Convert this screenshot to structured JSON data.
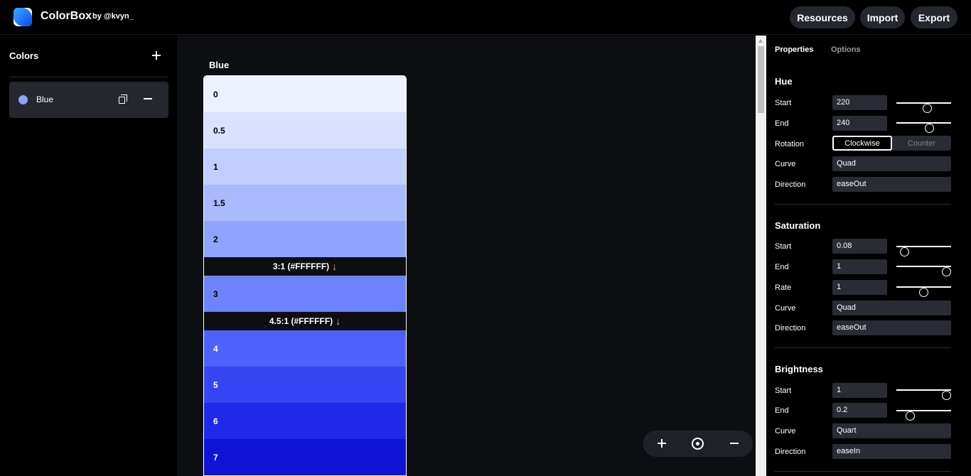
{
  "header": {
    "app_name": "ColorBox",
    "byline": "by @kvyn_",
    "buttons": {
      "resources": "Resources",
      "import": "Import",
      "export": "Export"
    }
  },
  "sidebar": {
    "title": "Colors",
    "items": [
      {
        "label": "Blue",
        "color": "#8ea2ff"
      }
    ]
  },
  "canvas": {
    "palette_name": "Blue",
    "swatches": [
      {
        "label": "0",
        "color": "#edf1ff",
        "text_color": "#000000"
      },
      {
        "label": "0.5",
        "color": "#d9e1ff",
        "text_color": "#000000"
      },
      {
        "label": "1",
        "color": "#c2ceff",
        "text_color": "#000000"
      },
      {
        "label": "1.5",
        "color": "#a9baff",
        "text_color": "#000000"
      },
      {
        "label": "2",
        "color": "#8fa4ff",
        "text_color": "#000000"
      },
      {
        "label": "3",
        "color": "#6e83fb",
        "text_color": "#000000"
      },
      {
        "label": "4",
        "color": "#4e62fb",
        "text_color": "#ffffff"
      },
      {
        "label": "5",
        "color": "#3645f3",
        "text_color": "#ffffff"
      },
      {
        "label": "6",
        "color": "#2129e8",
        "text_color": "#ffffff"
      },
      {
        "label": "7",
        "color": "#0f14d6",
        "text_color": "#ffffff"
      }
    ],
    "contrast_markers": {
      "first": {
        "text": "3:1 (#FFFFFF)",
        "arrow": "↓"
      },
      "second": {
        "text": "4.5:1 (#FFFFFF)",
        "arrow": "↓"
      }
    }
  },
  "panel": {
    "tabs": {
      "properties": "Properties",
      "options": "Options"
    },
    "labels": {
      "start": "Start",
      "end": "End",
      "rotation": "Rotation",
      "curve": "Curve",
      "direction": "Direction",
      "rate": "Rate"
    },
    "hue": {
      "title": "Hue",
      "start": "220",
      "end": "240",
      "start_level": 0.58,
      "end_level": 0.63,
      "rotation_selected": "Clockwise",
      "rotation_other": "Counter",
      "curve": "Quad",
      "direction": "easeOut"
    },
    "saturation": {
      "title": "Saturation",
      "start": "0.08",
      "end": "1",
      "rate": "1",
      "start_level": 0.08,
      "end_level": 1.0,
      "rate_level": 0.5,
      "curve": "Quad",
      "direction": "easeOut"
    },
    "brightness": {
      "title": "Brightness",
      "start": "1",
      "end": "0.2",
      "start_level": 1.0,
      "end_level": 0.2,
      "curve": "Quart",
      "direction": "easeIn"
    }
  }
}
